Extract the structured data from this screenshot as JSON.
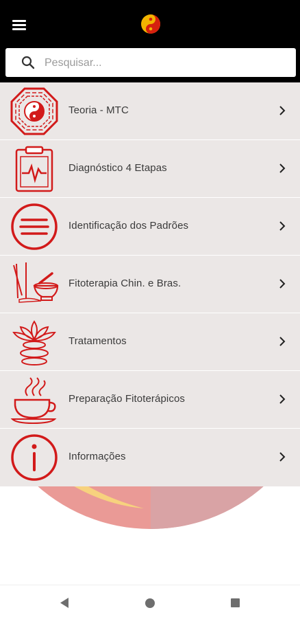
{
  "header": {
    "menu_icon": "hamburger-icon",
    "logo_icon": "yin-yang-icon"
  },
  "search": {
    "placeholder": "Pesquisar...",
    "value": "",
    "icon": "search-icon"
  },
  "menu": {
    "items": [
      {
        "label": "Teoria - MTC",
        "icon": "bagua-yin-yang-icon"
      },
      {
        "label": "Diagnóstico 4 Etapas",
        "icon": "clipboard-heartbeat-icon"
      },
      {
        "label": "Identificação dos Padrões",
        "icon": "list-circle-icon"
      },
      {
        "label": "Fitoterapia Chin. e Bras.",
        "icon": "mortar-pestle-icon"
      },
      {
        "label": "Tratamentos",
        "icon": "lotus-stones-icon"
      },
      {
        "label": "Preparação Fitoterápicos",
        "icon": "tea-cup-icon"
      },
      {
        "label": "Informações",
        "icon": "info-icon"
      }
    ]
  },
  "navbar": {
    "back_icon": "back-triangle-icon",
    "home_icon": "home-circle-icon",
    "recents_icon": "recents-square-icon"
  },
  "colors": {
    "accent": "#d21a1a",
    "list_background": "#ebe7e6",
    "appbar": "#000000"
  }
}
